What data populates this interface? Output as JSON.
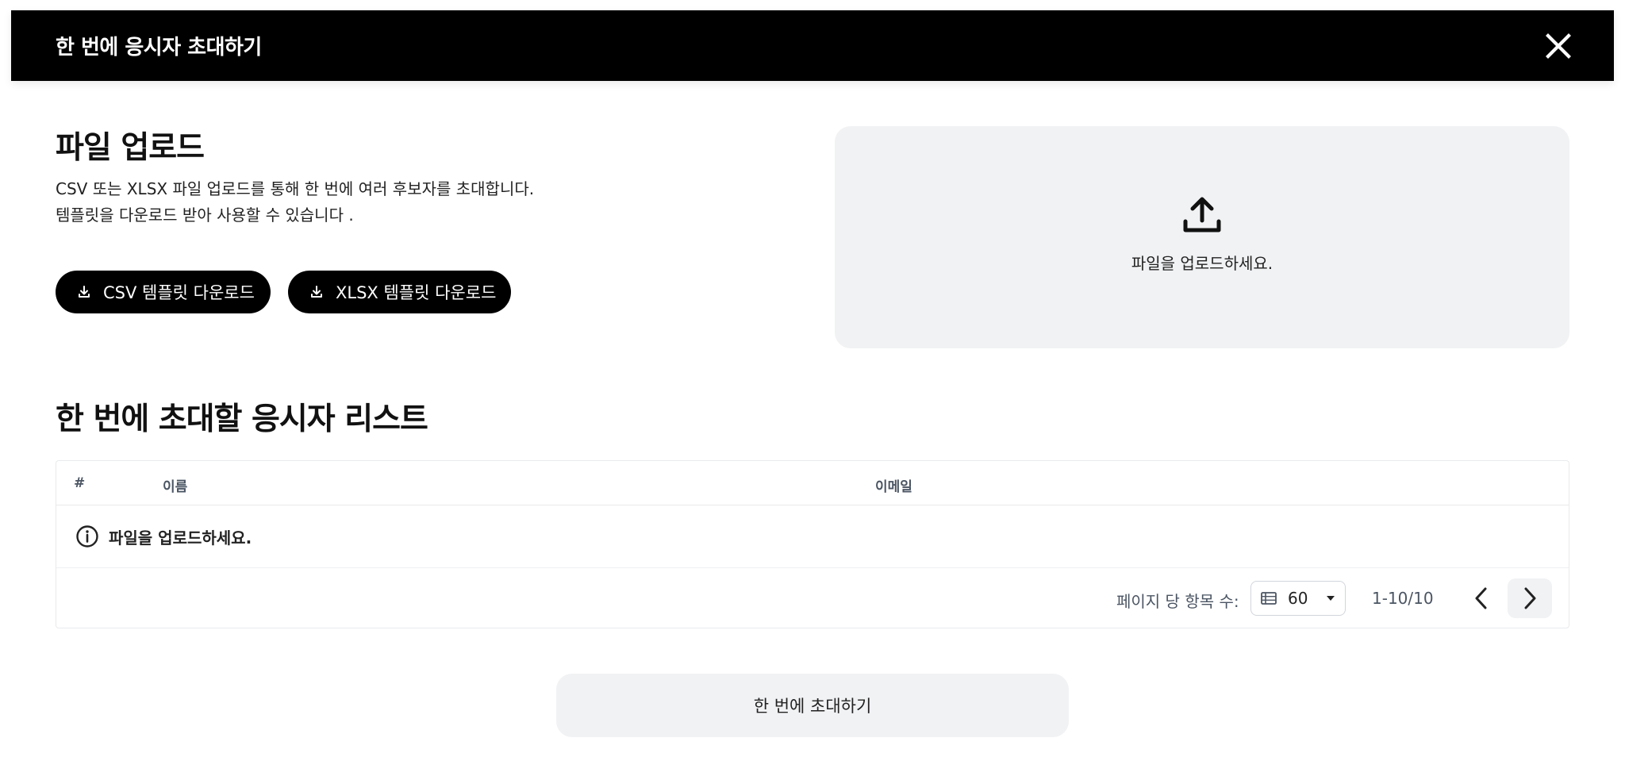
{
  "dialog": {
    "title": "한 번에  응시자 초대하기",
    "close_icon": "close-icon"
  },
  "upload": {
    "title": "파일 업로드",
    "description_line1": "CSV 또는 XLSX 파일 업로드를 통해 한 번에 여러 후보자를 초대합니다.",
    "description_line2": "템플릿을 다운로드 받아 사용할 수 있습니다 .",
    "csv_button_label": "CSV 템플릿 다운로드",
    "xlsx_button_label": "XLSX 템플릿 다운로드",
    "download_icon": "download-icon",
    "dropzone_icon": "upload-icon",
    "dropzone_text": "파일을 업로드하세요."
  },
  "list": {
    "title": "한 번에 초대할 응시자 리스트",
    "columns": [
      "#",
      "이름",
      "이메일"
    ],
    "empty_message": "파일을 업로드하세요.",
    "empty_icon": "info-icon"
  },
  "pagination": {
    "per_page_label": "페이지 당 항목 수:",
    "per_page_value": "60",
    "range_text": "1-10/10",
    "prev_icon": "chevron-left-icon",
    "next_icon": "chevron-right-icon"
  },
  "submit": {
    "label": "한 번에 초대하기"
  },
  "colors": {
    "header_bg": "#000000",
    "button_bg": "#000000",
    "panel_bg": "#f1f2f4",
    "border": "#e9eaec"
  }
}
